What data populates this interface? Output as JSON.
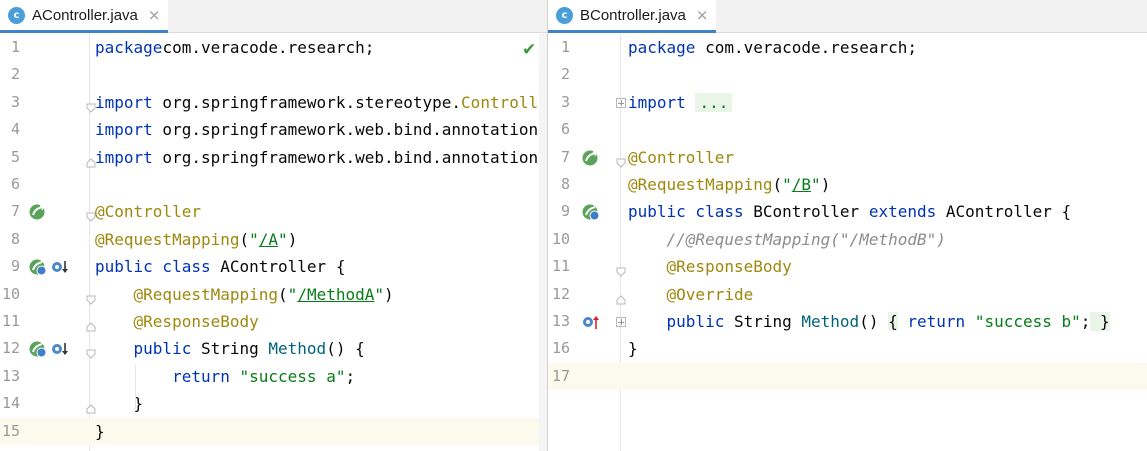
{
  "left": {
    "tab": {
      "icon": "class-icon",
      "icon_letter": "c",
      "title": "AController.java",
      "close": "×"
    },
    "status_icon": "check-icon",
    "lines": [
      {
        "n": "1",
        "tokens": [
          [
            "kw",
            "package"
          ],
          [
            "",
            "com.veracode.research;"
          ]
        ]
      },
      {
        "n": "2",
        "tokens": []
      },
      {
        "n": "3",
        "tokens": [
          [
            "kw",
            "import"
          ],
          [
            "",
            " org.springframework.stereotype."
          ],
          [
            "an",
            "Controller"
          ]
        ]
      },
      {
        "n": "4",
        "tokens": [
          [
            "kw",
            "import"
          ],
          [
            "",
            " org.springframework.web.bind.annotation"
          ]
        ]
      },
      {
        "n": "5",
        "tokens": [
          [
            "kw",
            "import"
          ],
          [
            "",
            " org.springframework.web.bind.annotation"
          ]
        ]
      },
      {
        "n": "6",
        "tokens": []
      },
      {
        "n": "7",
        "tokens": [
          [
            "an",
            "@Controller"
          ]
        ]
      },
      {
        "n": "8",
        "tokens": [
          [
            "an",
            "@RequestMapping"
          ],
          [
            "",
            "("
          ],
          [
            "str",
            "\""
          ],
          [
            "strlink",
            "/A"
          ],
          [
            "str",
            "\""
          ],
          [
            "",
            ")"
          ]
        ]
      },
      {
        "n": "9",
        "tokens": [
          [
            "kw",
            "public class"
          ],
          [
            "",
            " AController {"
          ]
        ]
      },
      {
        "n": "10",
        "tokens": [
          [
            "",
            "    "
          ],
          [
            "an",
            "@RequestMapping"
          ],
          [
            "",
            "("
          ],
          [
            "str",
            "\""
          ],
          [
            "strlink",
            "/MethodA"
          ],
          [
            "str",
            "\""
          ],
          [
            "",
            ")"
          ]
        ]
      },
      {
        "n": "11",
        "tokens": [
          [
            "",
            "    "
          ],
          [
            "an",
            "@ResponseBody"
          ]
        ]
      },
      {
        "n": "12",
        "tokens": [
          [
            "",
            "    "
          ],
          [
            "kw",
            "public"
          ],
          [
            "",
            " String "
          ],
          [
            "fn",
            "Method"
          ],
          [
            "",
            "() {"
          ]
        ]
      },
      {
        "n": "13",
        "tokens": [
          [
            "",
            "        "
          ],
          [
            "kw",
            "return"
          ],
          [
            "",
            " "
          ],
          [
            "str",
            "\"success a\""
          ],
          [
            "",
            ";"
          ]
        ]
      },
      {
        "n": "14",
        "tokens": [
          [
            "",
            "    }"
          ]
        ]
      },
      {
        "n": "15",
        "tokens": [
          [
            "",
            "}"
          ]
        ]
      }
    ],
    "current_line": "15"
  },
  "right": {
    "tab": {
      "icon": "class-icon",
      "icon_letter": "c",
      "title": "BController.java",
      "close": "×"
    },
    "lines": [
      {
        "n": "1",
        "tokens": [
          [
            "kw",
            "package"
          ],
          [
            "",
            " com.veracode.research;"
          ]
        ]
      },
      {
        "n": "2",
        "tokens": []
      },
      {
        "n": "3",
        "tokens": [
          [
            "kw",
            "import"
          ],
          [
            "",
            " "
          ],
          [
            "fold",
            "..."
          ]
        ]
      },
      {
        "n": "6",
        "tokens": []
      },
      {
        "n": "7",
        "tokens": [
          [
            "an",
            "@Controller"
          ]
        ]
      },
      {
        "n": "8",
        "tokens": [
          [
            "an",
            "@RequestMapping"
          ],
          [
            "",
            "("
          ],
          [
            "str",
            "\""
          ],
          [
            "strlink",
            "/B"
          ],
          [
            "str",
            "\""
          ],
          [
            "",
            ")"
          ]
        ]
      },
      {
        "n": "9",
        "tokens": [
          [
            "kw",
            "public class"
          ],
          [
            "",
            " BController "
          ],
          [
            "kw",
            "extends"
          ],
          [
            "",
            " AController {"
          ]
        ]
      },
      {
        "n": "10",
        "tokens": [
          [
            "",
            "    "
          ],
          [
            "cm",
            "//@RequestMapping(\"/MethodB\")"
          ]
        ]
      },
      {
        "n": "11",
        "tokens": [
          [
            "",
            "    "
          ],
          [
            "an",
            "@ResponseBody"
          ]
        ]
      },
      {
        "n": "12",
        "tokens": [
          [
            "",
            "    "
          ],
          [
            "an",
            "@Override"
          ]
        ]
      },
      {
        "n": "13",
        "tokens": [
          [
            "",
            "    "
          ],
          [
            "kw",
            "public"
          ],
          [
            "",
            " String "
          ],
          [
            "fn",
            "Method"
          ],
          [
            "",
            "() "
          ],
          [
            "brace",
            "{"
          ],
          [
            "",
            " "
          ],
          [
            "kw",
            "return"
          ],
          [
            "",
            " "
          ],
          [
            "str",
            "\"success b\""
          ],
          [
            "",
            ";"
          ],
          [
            "brace",
            " }"
          ]
        ]
      },
      {
        "n": "16",
        "tokens": [
          [
            "",
            "}"
          ]
        ]
      },
      {
        "n": "17",
        "tokens": []
      }
    ],
    "current_line": "17"
  }
}
